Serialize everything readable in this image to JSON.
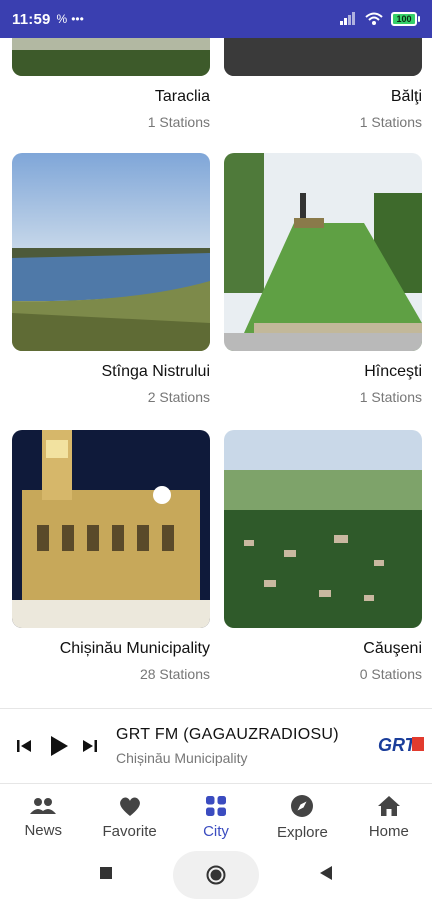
{
  "status_bar": {
    "time": "11:59",
    "left_icons": [
      "percent-icon",
      "more-dots-icon"
    ],
    "battery": "100",
    "background": "#3a3fb0"
  },
  "cities": [
    {
      "name": "Taraclia",
      "count": "1 Stations"
    },
    {
      "name": "Bălţi",
      "count": "1 Stations"
    },
    {
      "name": "Stînga Nistrului",
      "count": "2 Stations"
    },
    {
      "name": "Hînceşti",
      "count": "1 Stations"
    },
    {
      "name": "Chișinău Municipality",
      "count": "28 Stations"
    },
    {
      "name": "Căuşeni",
      "count": "0 Stations"
    }
  ],
  "player": {
    "title": "GRT FM (GAGAUZRADIOSU)",
    "subtitle": "Chișinău Municipality",
    "logo_text": "GRT"
  },
  "bottom_nav": {
    "items": [
      {
        "label": "News",
        "icon": "people-icon"
      },
      {
        "label": "Favorite",
        "icon": "heart-icon"
      },
      {
        "label": "City",
        "icon": "grid-icon",
        "active": true
      },
      {
        "label": "Explore",
        "icon": "compass-icon"
      },
      {
        "label": "Home",
        "icon": "home-icon"
      }
    ],
    "active_color": "#3b4cc0"
  }
}
